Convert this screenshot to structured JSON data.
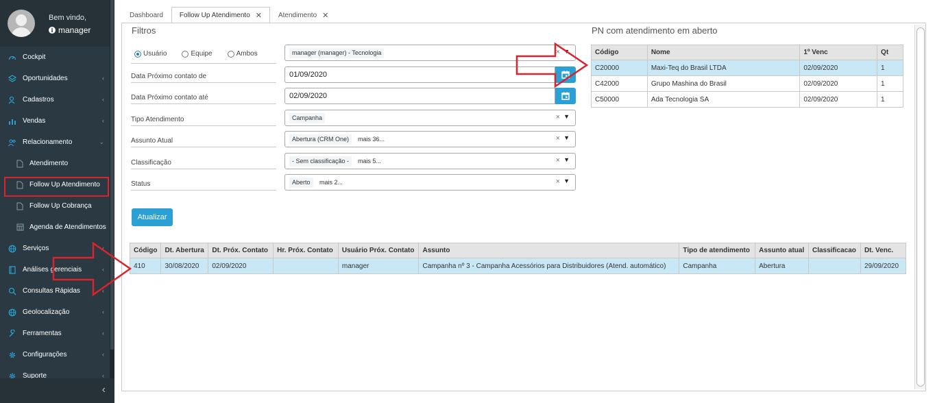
{
  "sidebar": {
    "welcome": "Bem vindo,",
    "username": "manager",
    "menu": [
      {
        "label": "Cockpit",
        "icon": "dashboard-icon",
        "chevron": false
      },
      {
        "label": "Oportunidades",
        "icon": "layers-icon",
        "chevron": true
      },
      {
        "label": "Cadastros",
        "icon": "user-icon",
        "chevron": true
      },
      {
        "label": "Vendas",
        "icon": "bar-chart-icon",
        "chevron": true
      },
      {
        "label": "Relacionamento",
        "icon": "users-icon",
        "chevron": true
      },
      {
        "label": "Atendimento",
        "icon": "file-icon",
        "chevron": false,
        "sub": true
      },
      {
        "label": "Follow Up Atendimento",
        "icon": "file-icon",
        "chevron": false,
        "sub": true,
        "active": true
      },
      {
        "label": "Follow Up Cobrança",
        "icon": "file-icon",
        "chevron": false,
        "sub": true
      },
      {
        "label": "Agenda de Atendimentos",
        "icon": "calendar-grid-icon",
        "chevron": false,
        "sub": true
      },
      {
        "label": "Serviços",
        "icon": "globe-icon",
        "chevron": true
      },
      {
        "label": "Análises gerenciais",
        "icon": "book-icon",
        "chevron": true
      },
      {
        "label": "Consultas Rápidas",
        "icon": "search-icon",
        "chevron": true
      },
      {
        "label": "Geolocalização",
        "icon": "globe-icon",
        "chevron": true
      },
      {
        "label": "Ferramentas",
        "icon": "wrench-icon",
        "chevron": true
      },
      {
        "label": "Configurações",
        "icon": "gear-icon",
        "chevron": true
      },
      {
        "label": "Suporte",
        "icon": "gear-icon",
        "chevron": true
      }
    ],
    "collapse_glyph": "‹"
  },
  "tabs": [
    {
      "label": "Dashboard",
      "closable": false
    },
    {
      "label": "Follow Up Atendimento",
      "closable": true,
      "active": true
    },
    {
      "label": "Atendimento",
      "closable": true
    }
  ],
  "filters": {
    "title": "Filtros",
    "radios": [
      "Usuário",
      "Equipe",
      "Ambos"
    ],
    "radio_selected": "Usuário",
    "user_tag": "manager (manager) - Tecnologia",
    "date_from_label": "Data Próximo contato de",
    "date_from": "01/09/2020",
    "date_to_label": "Data Próximo contato até",
    "date_to": "02/09/2020",
    "tipo_label": "Tipo Atendimento",
    "tipo_tag": "Campanha",
    "assunto_label": "Assunto Atual",
    "assunto_tag": "Abertura (CRM One)",
    "assunto_more": "mais 36...",
    "classif_label": "Classificação",
    "classif_tag": "- Sem classificação -",
    "classif_more": "mais 5...",
    "status_label": "Status",
    "status_tag": "Aberto",
    "status_more": "mais 2...",
    "clear_glyph": "×",
    "caret_glyph": "▼",
    "update_button": "Atualizar"
  },
  "pn_panel": {
    "title": "PN com atendimento em aberto",
    "headers": [
      "Código",
      "Nome",
      "1º Venc",
      "Qt"
    ],
    "rows": [
      [
        "C20000",
        "Maxi-Teq do Brasil LTDA",
        "02/09/2020",
        "1"
      ],
      [
        "C42000",
        "Grupo Mashina do Brasil",
        "02/09/2020",
        "1"
      ],
      [
        "C50000",
        "Ada Tecnologia SA",
        "02/09/2020",
        "1"
      ]
    ]
  },
  "results": {
    "headers": [
      "Código",
      "Dt. Abertura",
      "Dt. Próx. Contato",
      "Hr. Próx. Contato",
      "Usuário Próx. Contato",
      "Assunto",
      "Tipo de atendimento",
      "Assunto atual",
      "Classificacao",
      "Dt. Venc."
    ],
    "rows": [
      [
        "410",
        "30/08/2020",
        "02/09/2020",
        "",
        "manager",
        "Campanha nº 3 - Campanha Acessórios para Distribuidores (Atend. automático)",
        "Campanha",
        "Abertura",
        "",
        "29/09/2020"
      ]
    ]
  },
  "colors": {
    "sidebar_bg": "#2b3a42",
    "accent": "#2aa0d4",
    "selected_row": "#c9e8f6",
    "annotation_red": "#d9232d"
  }
}
